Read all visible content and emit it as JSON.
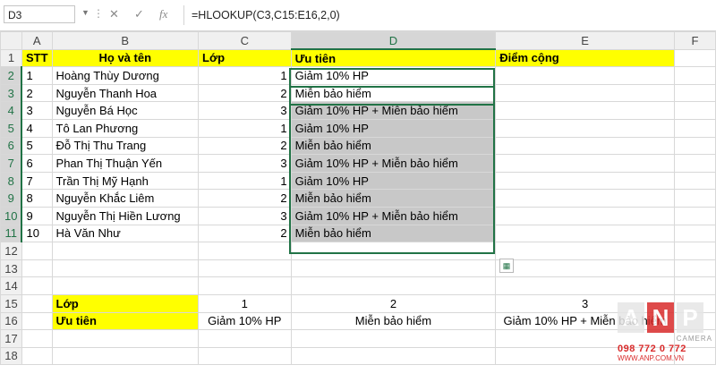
{
  "formula_bar": {
    "name_box": "D3",
    "formula": "=HLOOKUP(C3,C15:E16,2,0)",
    "cancel_icon": "x-icon",
    "enter_icon": "check-icon",
    "function_icon": "fx-icon"
  },
  "columns": [
    "A",
    "B",
    "C",
    "D",
    "E",
    "F"
  ],
  "rows": [
    "1",
    "2",
    "3",
    "4",
    "5",
    "6",
    "7",
    "8",
    "9",
    "10",
    "11",
    "12",
    "13",
    "14",
    "15",
    "16",
    "17",
    "18"
  ],
  "table": {
    "headers": [
      "STT",
      "Họ và tên",
      "Lớp",
      "Ưu tiên",
      "Điểm cộng"
    ],
    "data": [
      [
        "1",
        "Hoàng Thùy Dương",
        "1",
        "Giảm 10% HP"
      ],
      [
        "2",
        "Nguyễn Thanh Hoa",
        "2",
        "Miễn bảo hiểm"
      ],
      [
        "3",
        "Nguyễn Bá Học",
        "3",
        "Giảm 10% HP + Miễn bảo hiểm"
      ],
      [
        "4",
        "Tô Lan Phương",
        "1",
        "Giảm 10% HP"
      ],
      [
        "5",
        "Đỗ Thị Thu Trang",
        "2",
        "Miễn bảo hiểm"
      ],
      [
        "6",
        "Phan Thị Thuận Yến",
        "3",
        "Giảm 10% HP + Miễn bảo hiểm"
      ],
      [
        "7",
        "Trần Thị Mỹ Hạnh",
        "1",
        "Giảm 10% HP"
      ],
      [
        "8",
        "Nguyễn Khắc Liêm",
        "2",
        "Miễn bảo hiểm"
      ],
      [
        "9",
        "Nguyễn Thị Hiền Lương",
        "3",
        "Giảm 10% HP + Miễn bảo hiểm"
      ],
      [
        "10",
        "Hà Văn Như",
        "2",
        "Miễn bảo hiểm"
      ]
    ]
  },
  "lookup": {
    "row_label_1": "Lớp",
    "row_label_2": "Ưu tiên",
    "keys": [
      "1",
      "2",
      "3"
    ],
    "values": [
      "Giảm 10% HP",
      "Miễn bảo hiểm",
      "Giảm 10% HP + Miễn bảo hiểm"
    ]
  },
  "watermark": {
    "letters": [
      "A",
      "N",
      "P"
    ],
    "tagline": "CAMERA",
    "phone": "098 772 0 772",
    "website": "WWW.ANP.COM.VN"
  },
  "colors": {
    "header_fill": "#ffff00",
    "selection": "#217346",
    "gray_fill": "#c8c8c8"
  }
}
